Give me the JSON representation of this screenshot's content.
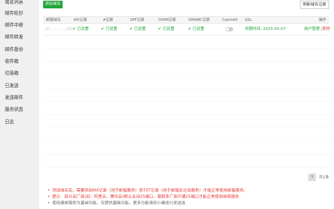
{
  "sidebar": {
    "items": [
      {
        "label": "域名列表"
      },
      {
        "label": "邮件轮抄"
      },
      {
        "label": "邮件中继"
      },
      {
        "label": "邮件转发"
      },
      {
        "label": "邮件备份"
      },
      {
        "label": "收件箱"
      },
      {
        "label": "垃圾箱"
      },
      {
        "label": "已发送"
      },
      {
        "label": "发送邮件"
      },
      {
        "label": "服务状态"
      },
      {
        "label": "日志"
      }
    ]
  },
  "toolbar": {
    "add_label": "添加域名",
    "refresh_label": "刷新域名记录"
  },
  "table": {
    "headers": [
      "邮箱域名",
      "MX记录",
      "A记录",
      "SPF记录",
      "DKIM记录",
      "DMARC记录",
      "CatchAll",
      "SSL",
      "操作"
    ],
    "rows": [
      {
        "domain": "kl..............ret",
        "mx": "已设置",
        "a": "已设置",
        "spf": "已设置",
        "dkim": "已设置",
        "dmarc": "已设置",
        "catchall": false,
        "ssl": "到期时间: 2025-05-07",
        "action_manage": "用户管理",
        "action_sep": "|",
        "action_delete": "删除"
      }
    ]
  },
  "pagination": {
    "current": "1",
    "total": "共1条"
  },
  "tips": [
    "添加域名后，需要添加MX记录（用于邮箱服务）和TXT记录（用于邮箱反垃圾服务）才能正常使用邮箱服务。",
    "提示：部分云厂商(如：阿里云、腾讯云)默认关闭25端口，需联系厂商开通25端口才能正常使用邮局服务",
    "使用建邮服务为基础功能，仅提供基础功能，更多功能请到小编进行发送选"
  ],
  "colors": {
    "accent": "#20a53a",
    "danger": "#d9534f",
    "tip_red": "#e53935"
  }
}
